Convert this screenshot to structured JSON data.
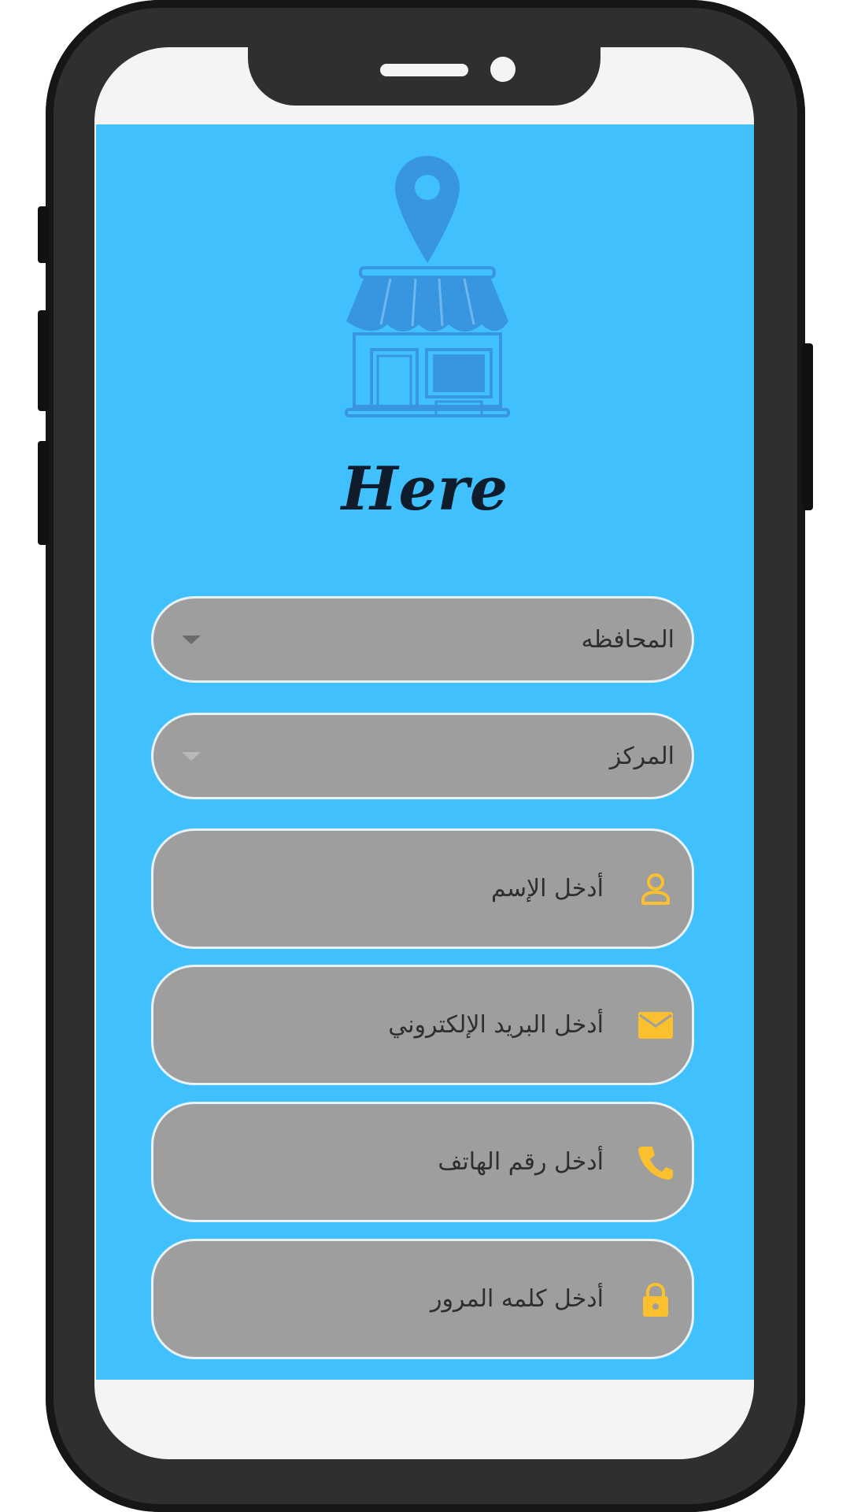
{
  "app": {
    "title": "Here",
    "background_color": "#40c1fd",
    "accent_color": "#fbc02d",
    "field_color": "#9e9e9e",
    "logo_icon": "store-location-icon"
  },
  "form": {
    "governorate": {
      "placeholder": "المحافظه",
      "icon": "caret-down-icon"
    },
    "center": {
      "placeholder": "المركز",
      "icon": "caret-down-icon"
    },
    "name": {
      "placeholder": "أدخل الإسم",
      "icon": "person-icon"
    },
    "email": {
      "placeholder": "أدخل البريد الإلكتروني",
      "icon": "mail-icon"
    },
    "phone": {
      "placeholder": "أدخل رقم الهاتف",
      "icon": "phone-icon"
    },
    "password": {
      "placeholder": "أدخل كلمه المرور",
      "icon": "lock-icon"
    }
  }
}
